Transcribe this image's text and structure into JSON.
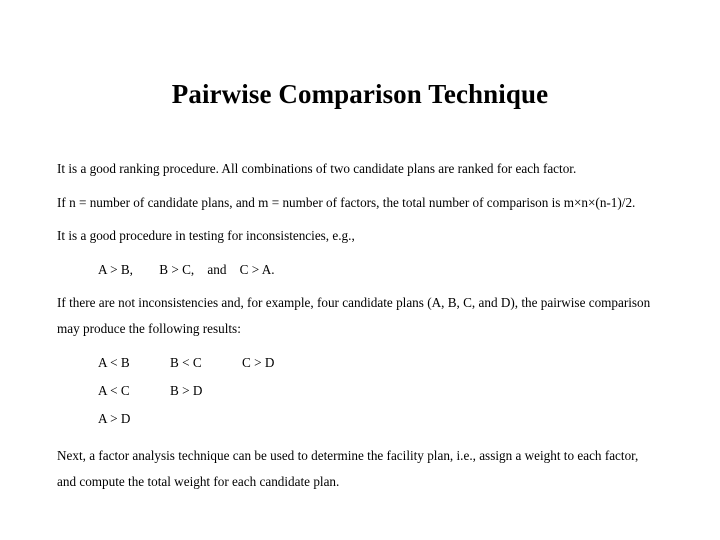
{
  "slide": {
    "title": "Pairwise Comparison Technique",
    "paragraphs": {
      "p1": "It is a good ranking procedure. All combinations of two candidate plans are ranked for each factor.",
      "p2": "If n = number of candidate plans, and m = number of factors, the total number of comparison is m×n×(n-1)/2.",
      "p3": "It is a good procedure in testing for inconsistencies, e.g.,",
      "p4": "If there are not inconsistencies and, for example, four candidate plans (A, B, C, and D), the pairwise comparison may produce the following results:",
      "p5": "Next, a factor analysis technique can be used to determine the facility plan, i.e., assign a weight to each factor, and compute the total weight for each candidate plan."
    },
    "inconsistency_example": "A > B,        B > C,    and    C > A.",
    "results_rows": [
      [
        "A < B",
        "B < C",
        "C > D"
      ],
      [
        "A < C",
        "B > D",
        ""
      ],
      [
        "A > D",
        "",
        ""
      ]
    ]
  }
}
